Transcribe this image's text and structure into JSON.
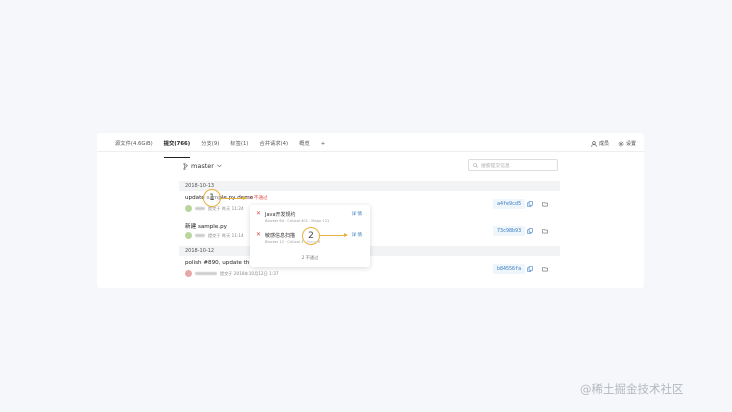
{
  "tabs": [
    {
      "label": "源文件(4.6GiB)"
    },
    {
      "label": "提交(766)"
    },
    {
      "label": "分支(9)"
    },
    {
      "label": "标签(1)"
    },
    {
      "label": "合并请求(4)"
    },
    {
      "label": "概览"
    },
    {
      "label": "+"
    }
  ],
  "actions": {
    "member": "成员",
    "settings": "设置"
  },
  "branch": {
    "name": "master"
  },
  "search": {
    "placeholder": "搜索提交信息"
  },
  "groups": [
    {
      "date": "2018-10-13"
    },
    {
      "date": "2018-10-12"
    }
  ],
  "commits": [
    {
      "title": "update sample.py demo",
      "author_suffix": "提交于 昨天 11:24",
      "hash": "a4fe9cd5"
    },
    {
      "title": "新建 sample.py",
      "author_suffix": "提交于 昨天 11:14",
      "hash": "73c98b93"
    },
    {
      "title": "polish #890, update thre",
      "author_suffix": "提交于 2018年10月12日 1:37",
      "hash": "b84556fa"
    }
  ],
  "status_fail": "不通过",
  "popover": {
    "items": [
      {
        "name": "Java开发规约",
        "meta": "Blocker 64 · Critical 401 · Major 121",
        "detail": "详 情"
      },
      {
        "name": "敏感信息扫描",
        "meta": "Blocker 12 · Critical 3 · Major 0",
        "detail": "详 情"
      }
    ],
    "summary": "2 不通过"
  },
  "callouts": {
    "one": "1",
    "two": "2"
  },
  "watermark": "@稀土掘金技术社区",
  "colors": {
    "fail": "#e05050",
    "link": "#3b7cc1",
    "callout": "#e8b040"
  }
}
